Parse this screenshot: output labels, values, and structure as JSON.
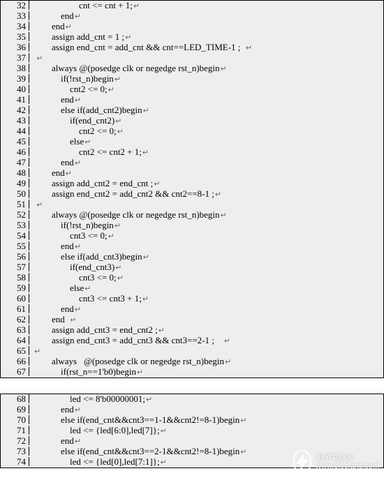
{
  "panels": [
    {
      "start": 32,
      "lines": [
        {
          "indent": 20,
          "text": "cnt <= cnt + 1;"
        },
        {
          "indent": 12,
          "text": "end"
        },
        {
          "indent": 8,
          "text": "end"
        },
        {
          "indent": 8,
          "text": "assign add_cnt = 1 ;"
        },
        {
          "indent": 8,
          "text": "assign end_cnt = add_cnt && cnt==LED_TIME-1 ;  "
        },
        {
          "indent": 0,
          "text": " "
        },
        {
          "indent": 8,
          "text": "always @(posedge clk or negedge rst_n)begin"
        },
        {
          "indent": 12,
          "text": "if(!rst_n)begin"
        },
        {
          "indent": 16,
          "text": "cnt2 <= 0;"
        },
        {
          "indent": 12,
          "text": "end"
        },
        {
          "indent": 12,
          "text": "else if(add_cnt2)begin"
        },
        {
          "indent": 16,
          "text": "if(end_cnt2)"
        },
        {
          "indent": 20,
          "text": "cnt2 <= 0;"
        },
        {
          "indent": 16,
          "text": "else"
        },
        {
          "indent": 20,
          "text": "cnt2 <= cnt2 + 1;"
        },
        {
          "indent": 12,
          "text": "end"
        },
        {
          "indent": 8,
          "text": "end"
        },
        {
          "indent": 8,
          "text": "assign add_cnt2 = end_cnt ;"
        },
        {
          "indent": 8,
          "text": "assign end_cnt2 = add_cnt2 && cnt2==8-1 ;"
        },
        {
          "indent": 0,
          "text": " "
        },
        {
          "indent": 8,
          "text": "always @(posedge clk or negedge rst_n)begin"
        },
        {
          "indent": 12,
          "text": "if(!rst_n)begin"
        },
        {
          "indent": 16,
          "text": "cnt3 <= 0;"
        },
        {
          "indent": 12,
          "text": "end"
        },
        {
          "indent": 12,
          "text": "else if(add_cnt3)begin"
        },
        {
          "indent": 16,
          "text": "if(end_cnt3)"
        },
        {
          "indent": 20,
          "text": "cnt3 <= 0;"
        },
        {
          "indent": 16,
          "text": "else"
        },
        {
          "indent": 20,
          "text": "cnt3 <= cnt3 + 1;"
        },
        {
          "indent": 12,
          "text": "end"
        },
        {
          "indent": 8,
          "text": "end  "
        },
        {
          "indent": 8,
          "text": "assign add_cnt3 = end_cnt2 ;"
        },
        {
          "indent": 8,
          "text": "assign end_cnt3 = add_cnt3 && cnt3==2-1 ;    "
        },
        {
          "indent": 0,
          "text": ""
        },
        {
          "indent": 8,
          "text": "always   @(posedge clk or negedge rst_n)begin"
        },
        {
          "indent": 12,
          "text": "if(rst_n==1'b0)begin"
        }
      ]
    },
    {
      "start": 68,
      "lines": [
        {
          "indent": 16,
          "text": "led <= 8'b00000001;"
        },
        {
          "indent": 12,
          "text": "end"
        },
        {
          "indent": 12,
          "text": "else if(end_cnt&&cnt3==1-1&&cnt2!=8-1)begin"
        },
        {
          "indent": 16,
          "text": "led <= {led[6:0],led[7]};"
        },
        {
          "indent": 12,
          "text": "end"
        },
        {
          "indent": 12,
          "text": "else if(end_cnt&&cnt3==2-1&&cnt2!=8-1)begin"
        },
        {
          "indent": 16,
          "text": "led <= {led[0],led[7:1]};"
        }
      ]
    }
  ],
  "watermark": {
    "title": "电子发烧友",
    "url": "www.elecfans.com"
  },
  "indent_unit": 8
}
